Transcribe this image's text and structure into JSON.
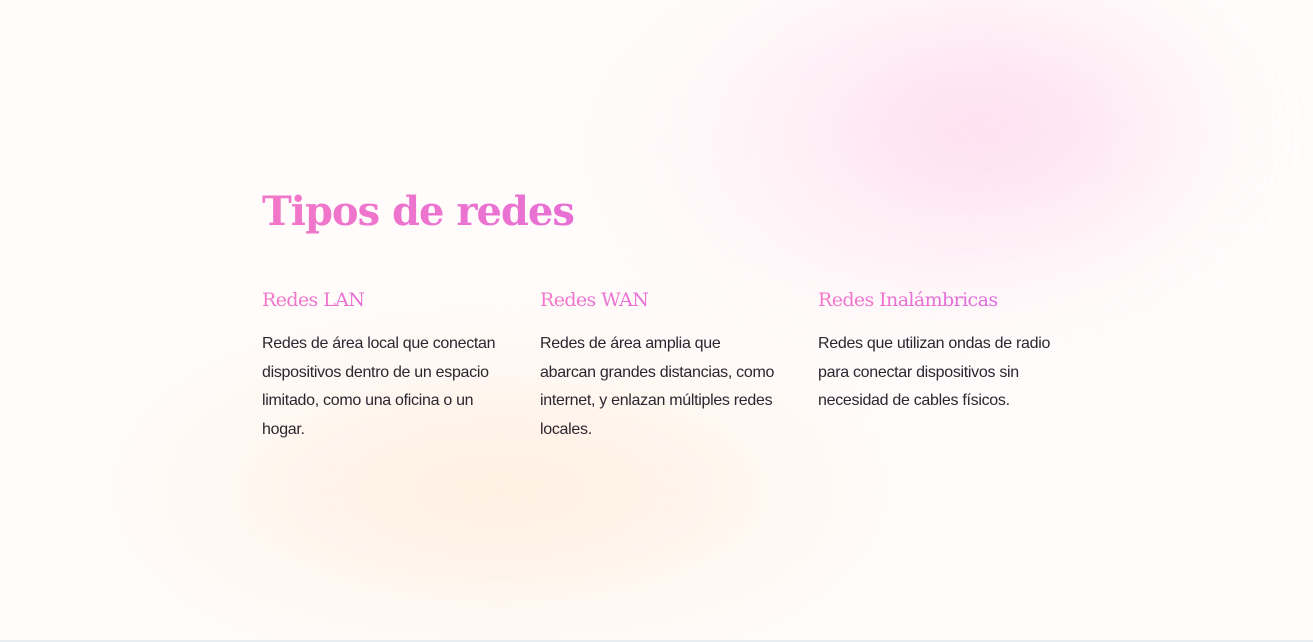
{
  "section": {
    "title": "Tipos de redes"
  },
  "cards": [
    {
      "title": "Redes LAN",
      "text": "Redes de área local que conectan dispositivos dentro de un espacio limitado, como una oficina o un hogar."
    },
    {
      "title": "Redes WAN",
      "text": "Redes de área amplia que abarcan grandes distancias, como internet, y enlazan múltiples redes locales."
    },
    {
      "title": "Redes Inalámbricas",
      "text": "Redes que utilizan ondas de radio para conectar dispositivos sin necesidad de cables físicos."
    }
  ],
  "colors": {
    "title_gradient_start": "#f277c8",
    "title_gradient_end": "#d765e8",
    "body_text": "#2b2530",
    "background": "#fffcfb"
  }
}
